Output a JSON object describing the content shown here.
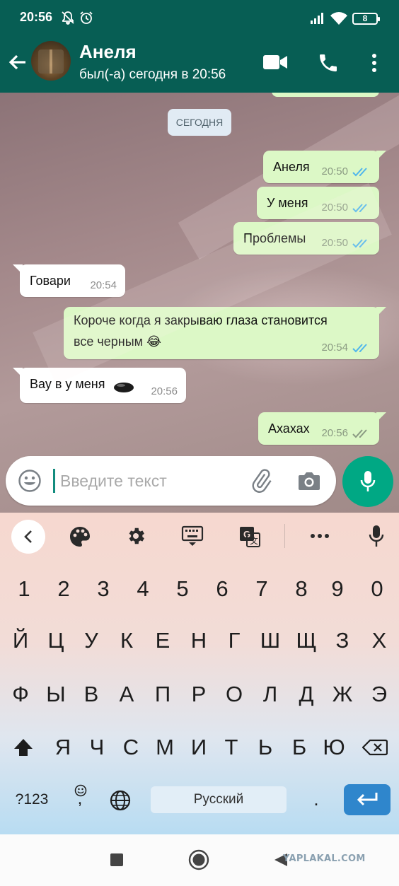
{
  "status_bar": {
    "time": "20:56",
    "battery": "8",
    "icons": [
      "bell-off-icon",
      "alarm-icon",
      "signal-icon",
      "wifi-icon",
      "battery-icon"
    ]
  },
  "header": {
    "contact_name": "Анеля",
    "last_seen": "был(-а) сегодня в 20:56",
    "icons": [
      "back-arrow-icon",
      "video-call-icon",
      "phone-icon",
      "more-vertical-icon"
    ],
    "bg_color": "#075e54"
  },
  "chat": {
    "date_chip": "СЕГОДНЯ",
    "messages": [
      {
        "dir": "out",
        "text": "Анеля",
        "time": "20:50",
        "status": "read"
      },
      {
        "dir": "out",
        "text": "У меня",
        "time": "20:50",
        "status": "read"
      },
      {
        "dir": "out",
        "text": "Проблемы",
        "time": "20:50",
        "status": "read"
      },
      {
        "dir": "in",
        "text": "Говари",
        "time": "20:54"
      },
      {
        "dir": "out",
        "text": "Короче когда я закрываю глаза становится",
        "text2": "все черным 😂",
        "time": "20:54",
        "status": "read"
      },
      {
        "dir": "in",
        "text": "Вау в у меня",
        "time": "20:56",
        "emoji": "black-oval"
      },
      {
        "dir": "out",
        "text": "Ахахах",
        "time": "20:56",
        "status": "delivered"
      }
    ],
    "colors": {
      "outgoing": "#dcf8c6",
      "incoming": "#ffffff",
      "read_ticks": "#4fb6ec",
      "delivered_ticks": "#8a9a82"
    }
  },
  "input": {
    "placeholder": "Введите текст",
    "icons": [
      "emoji-icon",
      "attach-icon",
      "camera-icon",
      "mic-icon"
    ],
    "fab_color": "#00a884"
  },
  "keyboard": {
    "toolbar_icons": [
      "back-icon",
      "palette-icon",
      "settings-icon",
      "keyboard-icon",
      "translate-icon",
      "more-icon",
      "mic-icon"
    ],
    "rows": [
      [
        "1",
        "2",
        "3",
        "4",
        "5",
        "6",
        "7",
        "8",
        "9",
        "0"
      ],
      [
        "Й",
        "Ц",
        "У",
        "К",
        "Е",
        "Н",
        "Г",
        "Ш",
        "Щ",
        "З",
        "Х"
      ],
      [
        "Ф",
        "Ы",
        "В",
        "А",
        "П",
        "Р",
        "О",
        "Л",
        "Д",
        "Ж",
        "Э"
      ],
      [
        "Я",
        "Ч",
        "С",
        "М",
        "И",
        "Т",
        "Ь",
        "Б",
        "Ю"
      ]
    ],
    "symbols_key": "?123",
    "comma_key": ",",
    "space_label": "Русский",
    "period_key": ".",
    "enter_color": "#2f86cc"
  },
  "navbar": {
    "icons": [
      "recents-square-icon",
      "home-circle-icon",
      "back-triangle-icon"
    ],
    "watermark": "YAPLAKAL.COM"
  }
}
